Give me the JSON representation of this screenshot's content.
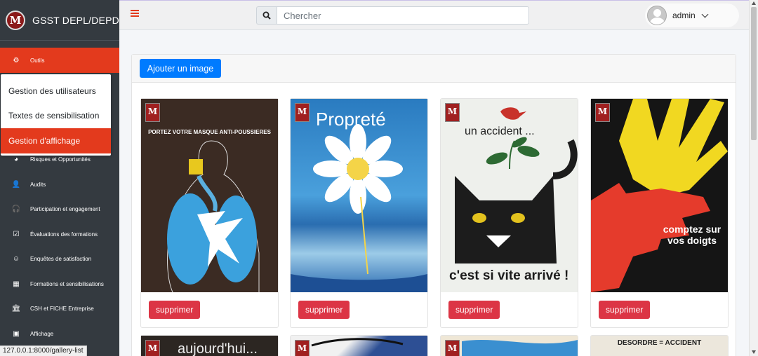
{
  "brand": {
    "title": "GSST DEPL/DEPD",
    "logo_letter": "M"
  },
  "sidebar": {
    "items": [
      {
        "label": "Outils",
        "icon": "gear-icon",
        "active": true
      },
      {
        "label": "Risques et Opportunités",
        "icon": "pie-chart-icon"
      },
      {
        "label": "Audits",
        "icon": "user-check-icon"
      },
      {
        "label": "Participation et engagement",
        "icon": "headset-icon"
      },
      {
        "label": "Évaluations des formations",
        "icon": "clipboard-check-icon"
      },
      {
        "label": "Enquêtes de satisfaction",
        "icon": "smile-icon"
      },
      {
        "label": "Formations et sensibilisations",
        "icon": "calendar-icon"
      },
      {
        "label": "CSH et FICHE Entreprise",
        "icon": "bank-icon"
      },
      {
        "label": "Affichage",
        "icon": "images-icon"
      }
    ],
    "submenu": [
      {
        "label": "Gestion des utilisateurs"
      },
      {
        "label": "Textes de sensibilisation"
      },
      {
        "label": "Gestion d'affichage",
        "active": true
      }
    ]
  },
  "header": {
    "search_placeholder": "Chercher",
    "user_name": "admin"
  },
  "gallery": {
    "add_label": "Ajouter un image",
    "delete_label": "supprimer",
    "posters": [
      {
        "text": "PORTEZ VOTRE MASQUE ANTI-POUSSIERES"
      },
      {
        "text": "Propreté"
      },
      {
        "text_top": "un accident ...",
        "text_bottom": "c'est si vite arrivé !"
      },
      {
        "text": "comptez sur vos doigts"
      }
    ],
    "row2": [
      {
        "text": "aujourd'hui..."
      },
      {
        "text": ""
      },
      {
        "text": ""
      },
      {
        "text": "DESORDRE = ACCIDENT"
      }
    ]
  },
  "status_url": "127.0.0.1:8000/gallery-list"
}
